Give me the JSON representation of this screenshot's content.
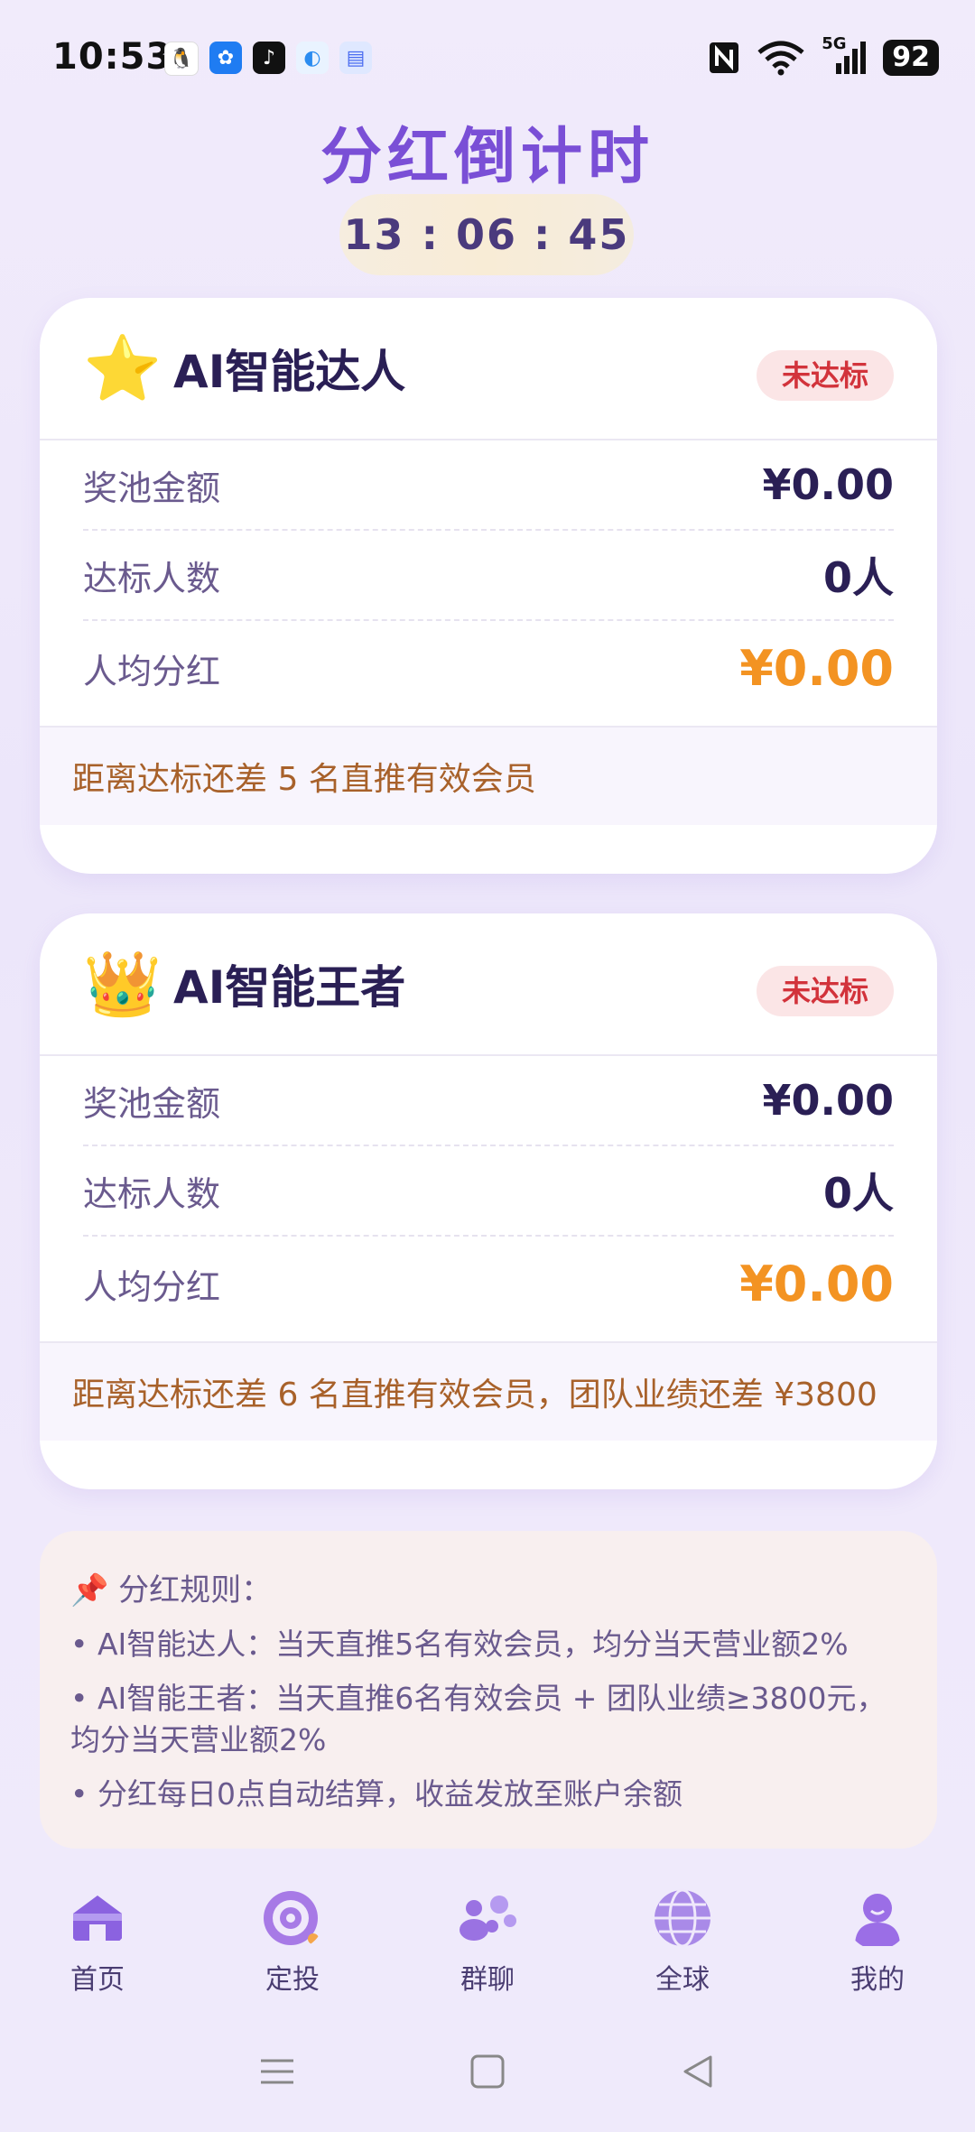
{
  "status_bar": {
    "time": "10:53",
    "apps": [
      {
        "icon": "qq-icon",
        "glyph": "🐧",
        "color": "#ffffff"
      },
      {
        "icon": "pinwheel-icon",
        "glyph": "✿",
        "color": "#1f7cf2"
      },
      {
        "icon": "tiktok-icon",
        "glyph": "♪",
        "color": "#111111"
      },
      {
        "icon": "browser-icon",
        "glyph": "◐",
        "color": "#e9f3ff"
      },
      {
        "icon": "message-icon",
        "glyph": "▤",
        "color": "#dfe8ff"
      }
    ],
    "network": "5G",
    "battery": "92"
  },
  "header": {
    "title": "分红倒计时",
    "countdown": "13 : 06 : 45"
  },
  "cards": [
    {
      "icon": "⭐",
      "title": "AI智能达人",
      "badge": "未达标",
      "rows": [
        {
          "label": "奖池金额",
          "value": "¥0.00"
        },
        {
          "label": "达标人数",
          "value": "0人"
        },
        {
          "label": "人均分红",
          "value": "¥0.00"
        }
      ],
      "footer": "距离达标还差 5 名直推有效会员"
    },
    {
      "icon": "👑",
      "title": "AI智能王者",
      "badge": "未达标",
      "rows": [
        {
          "label": "奖池金额",
          "value": "¥0.00"
        },
        {
          "label": "达标人数",
          "value": "0人"
        },
        {
          "label": "人均分红",
          "value": "¥0.00"
        }
      ],
      "footer": "距离达标还差 6 名直推有效会员，团队业绩还差 ¥3800"
    }
  ],
  "rules": {
    "head": "📌 分红规则：",
    "items": [
      "• AI智能达人：当天直推5名有效会员，均分当天营业额2%",
      "• AI智能王者：当天直推6名有效会员 + 团队业绩≥3800元，均分当天营业额2%",
      "• 分红每日0点自动结算，收益发放至账户余额"
    ]
  },
  "nav": [
    {
      "label": "首页",
      "icon": "home-icon"
    },
    {
      "label": "定投",
      "icon": "target-icon"
    },
    {
      "label": "群聊",
      "icon": "group-chat-icon"
    },
    {
      "label": "全球",
      "icon": "globe-icon"
    },
    {
      "label": "我的",
      "icon": "profile-icon"
    }
  ],
  "colors": {
    "accent": "#7a4fd6",
    "amount_highlight": "#f39322",
    "badge_text": "#d2333b",
    "footer_text": "#a8612a"
  }
}
